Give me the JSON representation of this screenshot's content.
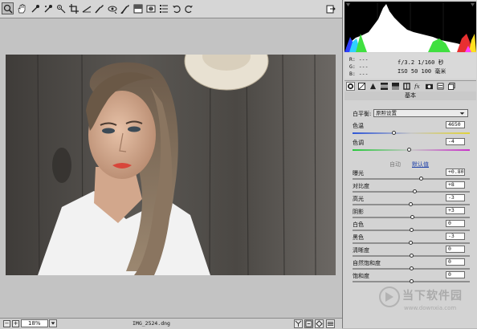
{
  "toolbar": {
    "tools": [
      "zoom-icon",
      "hand-icon",
      "white-balance-icon",
      "color-sampler-icon",
      "target-adjust-icon",
      "crop-icon",
      "straighten-icon",
      "spot-removal-icon",
      "red-eye-icon",
      "adjustment-brush-icon",
      "graduated-filter-icon",
      "radial-filter-icon",
      "preferences-icon",
      "rotate-left-icon",
      "rotate-right-icon"
    ],
    "export_icon": "export-icon"
  },
  "status": {
    "zoom": "18%",
    "filename": "IMG_2524.dng"
  },
  "info": {
    "r_label": "R:",
    "r_value": "---",
    "g_label": "G:",
    "g_value": "---",
    "b_label": "B:",
    "b_value": "---",
    "aperture_shutter": "f/3.2   1/160 秒",
    "iso_focal": "ISO 50   100 毫米"
  },
  "panel_tabs": [
    "basic-icon",
    "tone-curve-icon",
    "detail-icon",
    "hsl-icon",
    "split-toning-icon",
    "lens-icon",
    "fx-icon",
    "camera-calibration-icon",
    "presets-icon",
    "snapshots-icon"
  ],
  "basic": {
    "title": "基本",
    "wb_label": "白平衡:",
    "wb_value": "原照设置",
    "temp_label": "色温",
    "temp_value": "4650",
    "temp_pos": 0.35,
    "tint_label": "色调",
    "tint_value": "-4",
    "tint_pos": 0.48,
    "auto_link": "自动",
    "default_link": "默认值",
    "sliders": [
      {
        "label": "曝光",
        "value": "+0.80",
        "pos": 0.58
      },
      {
        "label": "对比度",
        "value": "+8",
        "pos": 0.53
      },
      {
        "label": "高光",
        "value": "-3",
        "pos": 0.49
      },
      {
        "label": "阴影",
        "value": "+3",
        "pos": 0.51
      },
      {
        "label": "白色",
        "value": "0",
        "pos": 0.5
      },
      {
        "label": "黑色",
        "value": "-3",
        "pos": 0.49
      },
      {
        "label": "清晰度",
        "value": "0",
        "pos": 0.5
      },
      {
        "label": "自然饱和度",
        "value": "0",
        "pos": 0.5
      },
      {
        "label": "饱和度",
        "value": "0",
        "pos": 0.5
      }
    ]
  },
  "watermark": {
    "text": "当下软件园",
    "url": "www.downxia.com"
  }
}
